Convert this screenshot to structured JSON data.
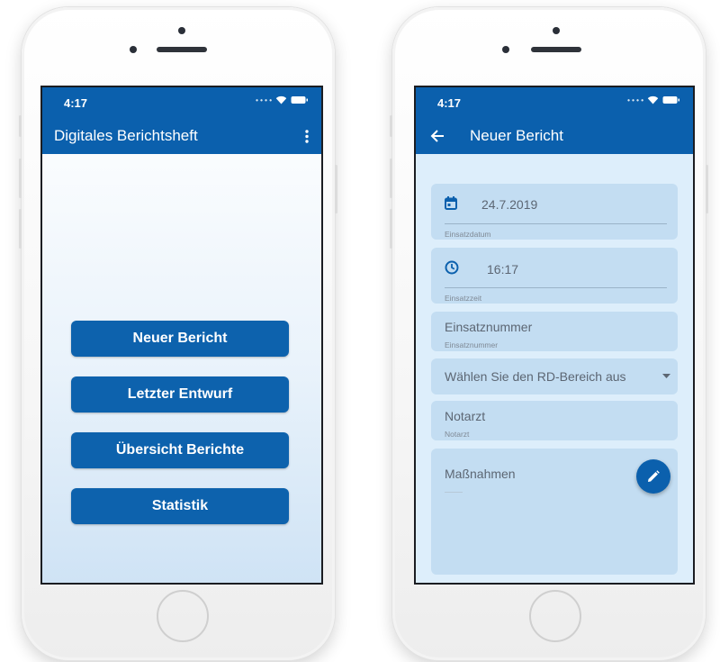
{
  "left_phone": {
    "status": {
      "time": "4:17"
    },
    "appbar": {
      "title": "Digitales Berichtsheft",
      "menu_icon": "more-vert-icon"
    },
    "buttons": [
      "Neuer Bericht",
      "Letzter Entwurf",
      "Übersicht Berichte",
      "Statistik"
    ]
  },
  "right_phone": {
    "status": {
      "time": "4:17"
    },
    "appbar": {
      "title": "Neuer Bericht",
      "back_icon": "arrow-back-icon"
    },
    "form": {
      "date": {
        "value": "24.7.2019",
        "helper": "Einsatzdatum",
        "icon": "calendar-icon"
      },
      "time": {
        "value": "16:17",
        "helper": "Einsatzzeit",
        "icon": "clock-icon"
      },
      "number": {
        "value": "Einsatznummer",
        "helper": "Einsatznummer"
      },
      "area": {
        "value": "Wählen Sie den RD-Bereich aus",
        "icon": "dropdown-arrow-icon"
      },
      "doctor": {
        "value": "Notarzt",
        "helper": "Notarzt"
      },
      "measures": {
        "value": "Maßnahmen",
        "icon": "pencil-icon"
      }
    }
  },
  "colors": {
    "primary": "#0b60ad",
    "field_bg": "#c3ddf2",
    "form_bg": "#ddeefb"
  }
}
